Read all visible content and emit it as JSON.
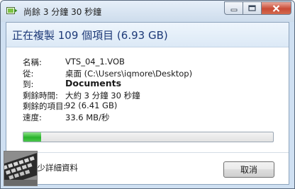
{
  "window": {
    "title": "尚餘 3 分鐘 30 秒鐘"
  },
  "header": {
    "title": "正在複製 109 個項目 (6.93 GB)"
  },
  "details": {
    "rows": [
      {
        "label": "名稱:",
        "value": "VTS_04_1.VOB"
      },
      {
        "label": "從:",
        "value": "桌面 (C:\\Users\\iqmore\\Desktop)"
      },
      {
        "label": "到:",
        "value": "Documents"
      },
      {
        "label": "剩餘時間:",
        "value": "大約 3 分鐘 30 秒鐘"
      },
      {
        "label": "剩餘的項目:",
        "value": "92 (6.41 GB)"
      },
      {
        "label": "速度:",
        "value": "33.6 MB/秒"
      }
    ]
  },
  "progress": {
    "fraction": 0.07,
    "color": "#29b32c"
  },
  "footer": {
    "more_label": "較少詳細資料",
    "cancel_label": "取消"
  },
  "icons": {
    "app": "copy-app-icon",
    "minimize": "minimize-icon",
    "maximize": "maximize-icon",
    "close": "close-icon",
    "more": "chevron-up-icon"
  }
}
